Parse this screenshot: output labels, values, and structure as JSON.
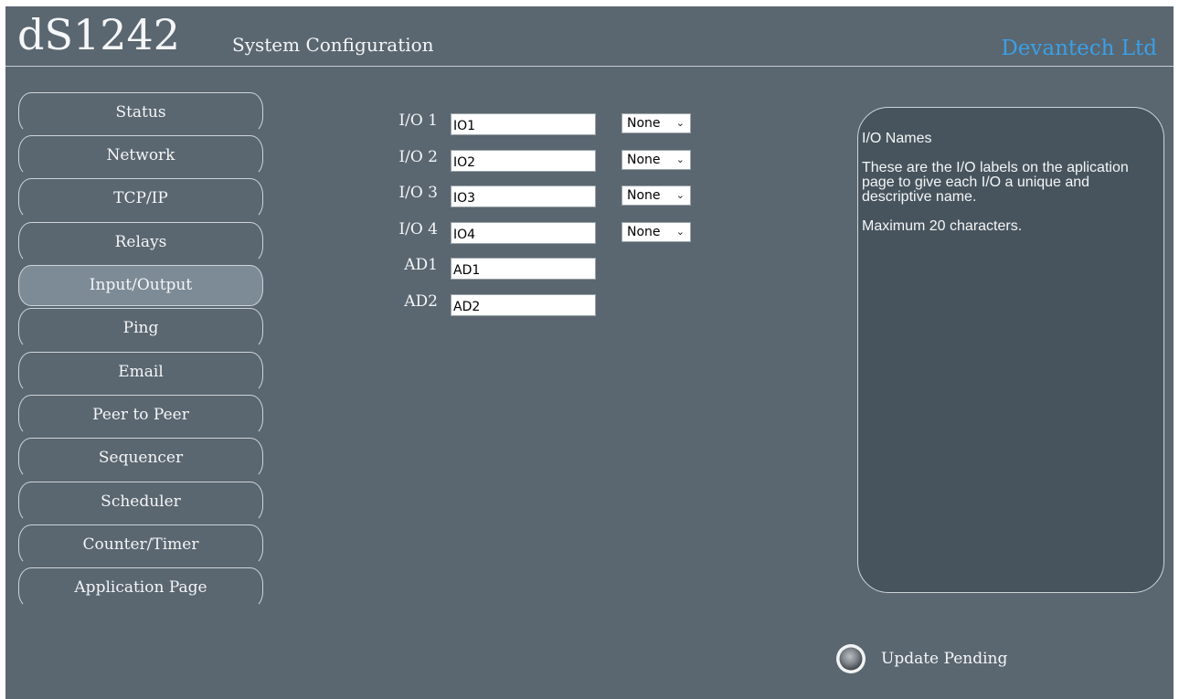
{
  "header": {
    "product": "dS1242",
    "subtitle": "System Configuration",
    "company": "Devantech Ltd"
  },
  "sidebar": {
    "active": "Input/Output",
    "items": [
      {
        "label": "Status"
      },
      {
        "label": "Network"
      },
      {
        "label": "TCP/IP"
      },
      {
        "label": "Relays"
      },
      {
        "label": "Input/Output"
      },
      {
        "label": "Ping"
      },
      {
        "label": "Email"
      },
      {
        "label": "Peer to Peer"
      },
      {
        "label": "Sequencer"
      },
      {
        "label": "Scheduler"
      },
      {
        "label": "Counter/Timer"
      },
      {
        "label": "Application Page"
      }
    ]
  },
  "form": {
    "rows": [
      {
        "label": "I/O 1",
        "value": "IO1",
        "select": "None"
      },
      {
        "label": "I/O 2",
        "value": "IO2",
        "select": "None"
      },
      {
        "label": "I/O 3",
        "value": "IO3",
        "select": "None"
      },
      {
        "label": "I/O 4",
        "value": "IO4",
        "select": "None"
      },
      {
        "label": "AD1",
        "value": "AD1"
      },
      {
        "label": "AD2",
        "value": "AD2"
      }
    ]
  },
  "help": {
    "title": "I/O Names",
    "body": "These are the I/O labels on the aplication page to give each I/O a unique and descriptive name.",
    "note": "Maximum 20 characters."
  },
  "status": {
    "text": "Update Pending",
    "led_color": "#8a8f93"
  },
  "colors": {
    "background": "#5a6670",
    "accent": "#3aa0e6",
    "active_nav": "#7d8b96",
    "help_panel": "#47545d"
  }
}
